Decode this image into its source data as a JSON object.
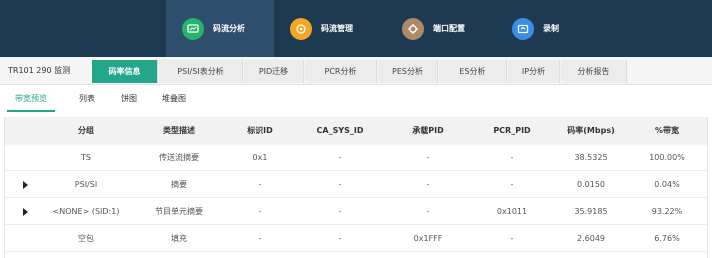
{
  "nav": {
    "items": [
      {
        "label": "码流分析",
        "icon": "stream-analysis-icon",
        "color": "#27b36a"
      },
      {
        "label": "码流管理",
        "icon": "stream-management-icon",
        "color": "#f5a623"
      },
      {
        "label": "端口配置",
        "icon": "port-config-icon",
        "color": "#b08968"
      },
      {
        "label": "录制",
        "icon": "record-icon",
        "color": "#3a8ee6"
      }
    ]
  },
  "page": {
    "title": "TR101 290 监测"
  },
  "tabs": [
    {
      "label": "码率信息"
    },
    {
      "label": "PSI/SI表分析"
    },
    {
      "label": "PID迁移"
    },
    {
      "label": "PCR分析"
    },
    {
      "label": "PES分析"
    },
    {
      "label": "ES分析"
    },
    {
      "label": "IP分析"
    },
    {
      "label": "分析报告"
    }
  ],
  "subtabs": [
    {
      "label": "带宽预览"
    },
    {
      "label": "列表"
    },
    {
      "label": "饼图"
    },
    {
      "label": "堆叠图"
    }
  ],
  "table": {
    "headers": [
      "分组",
      "类型描述",
      "标识ID",
      "CA_SYS_ID",
      "承载PID",
      "PCR_PID",
      "码率(Mbps)",
      "%带宽"
    ],
    "rows": [
      {
        "expandable": false,
        "cells": [
          "TS",
          "传送流摘要",
          "0x1",
          "-",
          "-",
          "-",
          "38.5325",
          "100.00%"
        ]
      },
      {
        "expandable": true,
        "cells": [
          "PSI/SI",
          "摘要",
          "-",
          "-",
          "-",
          "-",
          "0.0150",
          "0.04%"
        ]
      },
      {
        "expandable": true,
        "cells": [
          "<NONE> (SID:1)",
          "节目单元摘要",
          "-",
          "-",
          "-",
          "0x1011",
          "35.9185",
          "93.22%"
        ]
      },
      {
        "expandable": false,
        "cells": [
          "空包",
          "填充",
          "-",
          "-",
          "0x1FFF",
          "-",
          "2.6049",
          "6.76%"
        ]
      }
    ]
  },
  "colors": {
    "topbar": "#1e3a52",
    "accent": "#24a68a"
  }
}
